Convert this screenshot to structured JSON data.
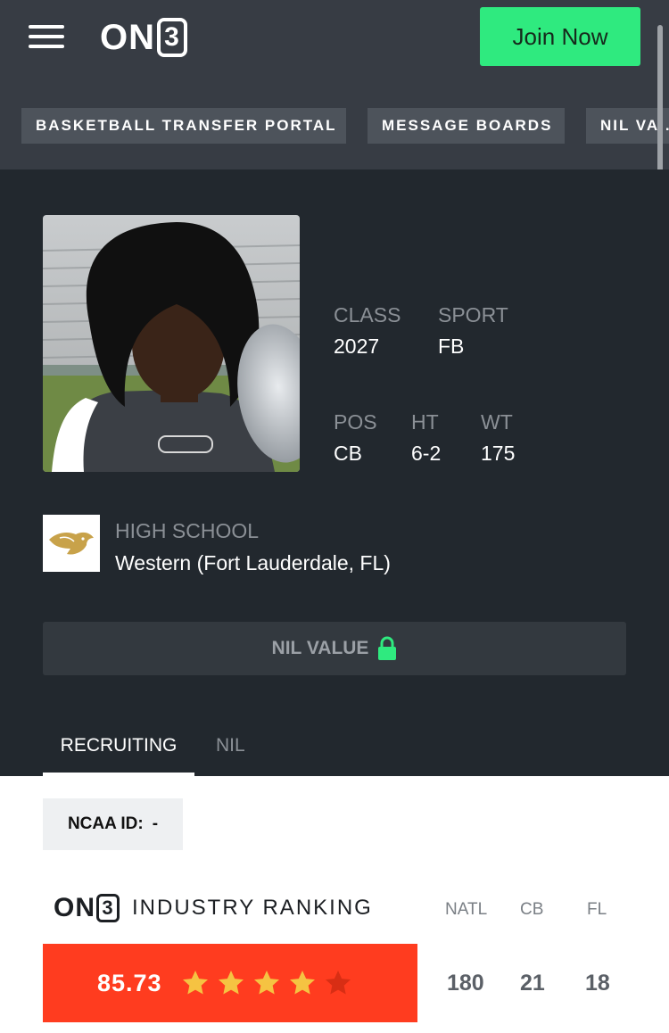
{
  "header": {
    "logo_text": "ON",
    "logo_box": "3",
    "join_label": "Join Now",
    "quick_links": [
      "BASKETBALL TRANSFER PORTAL",
      "MESSAGE BOARDS",
      "NIL VA..."
    ]
  },
  "profile": {
    "class_label": "CLASS",
    "class_value": "2027",
    "sport_label": "SPORT",
    "sport_value": "FB",
    "pos_label": "POS",
    "pos_value": "CB",
    "ht_label": "HT",
    "ht_value": "6-2",
    "wt_label": "WT",
    "wt_value": "175",
    "school_label": "HIGH SCHOOL",
    "school_value": "Western (Fort Lauderdale, FL)",
    "nil_label": "NIL VALUE",
    "tabs": [
      "RECRUITING",
      "NIL"
    ]
  },
  "recruiting": {
    "ncaa_label": "NCAA ID:",
    "ncaa_value": "-",
    "ranking_title": "INDUSTRY RANKING",
    "columns": [
      "NATL",
      "CB",
      "FL"
    ],
    "score": "85.73",
    "stars": 4,
    "stars_max": 5,
    "ranks": [
      "180",
      "21",
      "18"
    ]
  },
  "colors": {
    "accent_green": "#2fea7f",
    "score_red": "#ff3c1f",
    "star_gold": "#f5c342"
  }
}
